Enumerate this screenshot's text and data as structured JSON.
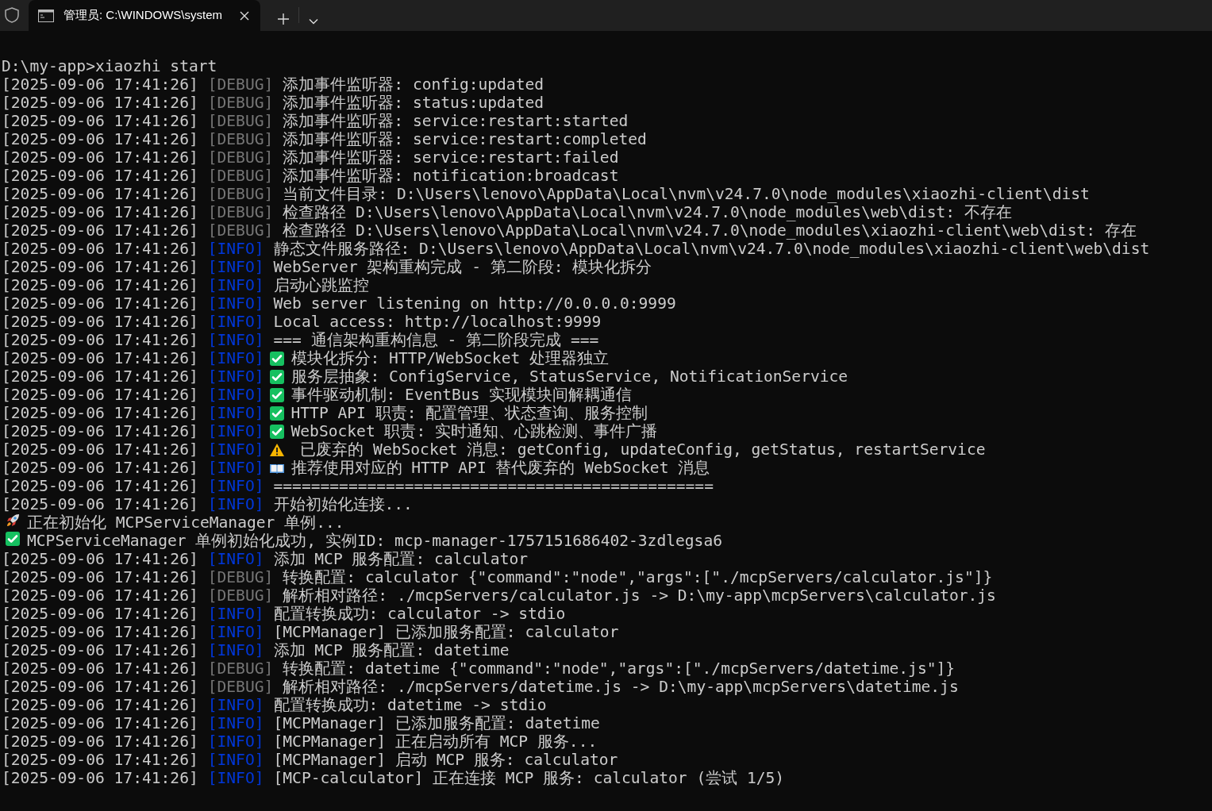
{
  "tab": {
    "title": "管理员: C:\\WINDOWS\\system",
    "selected": true
  },
  "lines": [
    {
      "kind": "command",
      "text": "D:\\my-app>xiaozhi start"
    },
    {
      "kind": "log",
      "time": "[2025-09-06 17:41:26]",
      "tag": "[DEBUG]",
      "color": "#767676",
      "message": "添加事件监听器: config:updated"
    },
    {
      "kind": "log",
      "time": "[2025-09-06 17:41:26]",
      "tag": "[DEBUG]",
      "color": "#767676",
      "message": "添加事件监听器: status:updated"
    },
    {
      "kind": "log",
      "time": "[2025-09-06 17:41:26]",
      "tag": "[DEBUG]",
      "color": "#767676",
      "message": "添加事件监听器: service:restart:started"
    },
    {
      "kind": "log",
      "time": "[2025-09-06 17:41:26]",
      "tag": "[DEBUG]",
      "color": "#767676",
      "message": "添加事件监听器: service:restart:completed"
    },
    {
      "kind": "log",
      "time": "[2025-09-06 17:41:26]",
      "tag": "[DEBUG]",
      "color": "#767676",
      "message": "添加事件监听器: service:restart:failed"
    },
    {
      "kind": "log",
      "time": "[2025-09-06 17:41:26]",
      "tag": "[DEBUG]",
      "color": "#767676",
      "message": "添加事件监听器: notification:broadcast"
    },
    {
      "kind": "log",
      "time": "[2025-09-06 17:41:26]",
      "tag": "[DEBUG]",
      "color": "#767676",
      "message": "当前文件目录: D:\\Users\\lenovo\\AppData\\Local\\nvm\\v24.7.0\\node_modules\\xiaozhi-client\\dist"
    },
    {
      "kind": "log",
      "time": "[2025-09-06 17:41:26]",
      "tag": "[DEBUG]",
      "color": "#767676",
      "message": "检查路径 D:\\Users\\lenovo\\AppData\\Local\\nvm\\v24.7.0\\node_modules\\web\\dist: 不存在"
    },
    {
      "kind": "log",
      "time": "[2025-09-06 17:41:26]",
      "tag": "[DEBUG]",
      "color": "#767676",
      "message": "检查路径 D:\\Users\\lenovo\\AppData\\Local\\nvm\\v24.7.0\\node_modules\\xiaozhi-client\\web\\dist: 存在"
    },
    {
      "kind": "log",
      "time": "[2025-09-06 17:41:26]",
      "tag": "[INFO]",
      "color": "#0037da",
      "message": "静态文件服务路径: D:\\Users\\lenovo\\AppData\\Local\\nvm\\v24.7.0\\node_modules\\xiaozhi-client\\web\\dist"
    },
    {
      "kind": "log",
      "time": "[2025-09-06 17:41:26]",
      "tag": "[INFO]",
      "color": "#0037da",
      "message": "WebServer 架构重构完成 - 第二阶段: 模块化拆分"
    },
    {
      "kind": "log",
      "time": "[2025-09-06 17:41:26]",
      "tag": "[INFO]",
      "color": "#0037da",
      "message": "启动心跳监控"
    },
    {
      "kind": "log",
      "time": "[2025-09-06 17:41:26]",
      "tag": "[INFO]",
      "color": "#0037da",
      "message": "Web server listening on http://0.0.0.0:9999"
    },
    {
      "kind": "log",
      "time": "[2025-09-06 17:41:26]",
      "tag": "[INFO]",
      "color": "#0037da",
      "message": "Local access: http://localhost:9999"
    },
    {
      "kind": "log",
      "time": "[2025-09-06 17:41:26]",
      "tag": "[INFO]",
      "color": "#0037da",
      "message": "=== 通信架构重构信息 - 第二阶段完成 ==="
    },
    {
      "kind": "log",
      "time": "[2025-09-06 17:41:26]",
      "tag": "[INFO]",
      "color": "#0037da",
      "symbol": {
        "kind": "check"
      },
      "message": "模块化拆分: HTTP/WebSocket 处理器独立"
    },
    {
      "kind": "log",
      "time": "[2025-09-06 17:41:26]",
      "tag": "[INFO]",
      "color": "#0037da",
      "symbol": {
        "kind": "check"
      },
      "message": "服务层抽象: ConfigService, StatusService, NotificationService"
    },
    {
      "kind": "log",
      "time": "[2025-09-06 17:41:26]",
      "tag": "[INFO]",
      "color": "#0037da",
      "symbol": {
        "kind": "check"
      },
      "message": "事件驱动机制: EventBus 实现模块间解耦通信"
    },
    {
      "kind": "log",
      "time": "[2025-09-06 17:41:26]",
      "tag": "[INFO]",
      "color": "#0037da",
      "symbol": {
        "kind": "check"
      },
      "message": "HTTP API 职责: 配置管理、状态查询、服务控制"
    },
    {
      "kind": "log",
      "time": "[2025-09-06 17:41:26]",
      "tag": "[INFO]",
      "color": "#0037da",
      "symbol": {
        "kind": "check"
      },
      "message": "WebSocket 职责: 实时通知、心跳检测、事件广播"
    },
    {
      "kind": "log",
      "time": "[2025-09-06 17:41:26]",
      "tag": "[INFO]",
      "color": "#0037da",
      "symbol": {
        "kind": "warning"
      },
      "message": " 已废弃的 WebSocket 消息: getConfig, updateConfig, getStatus, restartService"
    },
    {
      "kind": "log",
      "time": "[2025-09-06 17:41:26]",
      "tag": "[INFO]",
      "color": "#0037da",
      "symbol": {
        "kind": "book"
      },
      "message": "推荐使用对应的 HTTP API 替代废弃的 WebSocket 消息"
    },
    {
      "kind": "log",
      "time": "[2025-09-06 17:41:26]",
      "tag": "[INFO]",
      "color": "#0037da",
      "message": "==============================================="
    },
    {
      "kind": "log",
      "time": "[2025-09-06 17:41:26]",
      "tag": "[INFO]",
      "color": "#0037da",
      "message": "开始初始化连接..."
    },
    {
      "kind": "plain",
      "symbol": {
        "kind": "rocket"
      },
      "message": "正在初始化 MCPServiceManager 单例..."
    },
    {
      "kind": "plain",
      "symbol": {
        "kind": "check"
      },
      "message": "MCPServiceManager 单例初始化成功, 实例ID: mcp-manager-1757151686402-3zdlegsa6"
    },
    {
      "kind": "log",
      "time": "[2025-09-06 17:41:26]",
      "tag": "[INFO]",
      "color": "#0037da",
      "message": "添加 MCP 服务配置: calculator"
    },
    {
      "kind": "log",
      "time": "[2025-09-06 17:41:26]",
      "tag": "[DEBUG]",
      "color": "#767676",
      "message": "转换配置: calculator {\"command\":\"node\",\"args\":[\"./mcpServers/calculator.js\"]}"
    },
    {
      "kind": "log",
      "time": "[2025-09-06 17:41:26]",
      "tag": "[DEBUG]",
      "color": "#767676",
      "message": "解析相对路径: ./mcpServers/calculator.js -> D:\\my-app\\mcpServers\\calculator.js"
    },
    {
      "kind": "log",
      "time": "[2025-09-06 17:41:26]",
      "tag": "[INFO]",
      "color": "#0037da",
      "message": "配置转换成功: calculator -> stdio"
    },
    {
      "kind": "log",
      "time": "[2025-09-06 17:41:26]",
      "tag": "[INFO]",
      "color": "#0037da",
      "message": "[MCPManager] 已添加服务配置: calculator"
    },
    {
      "kind": "log",
      "time": "[2025-09-06 17:41:26]",
      "tag": "[INFO]",
      "color": "#0037da",
      "message": "添加 MCP 服务配置: datetime"
    },
    {
      "kind": "log",
      "time": "[2025-09-06 17:41:26]",
      "tag": "[DEBUG]",
      "color": "#767676",
      "message": "转换配置: datetime {\"command\":\"node\",\"args\":[\"./mcpServers/datetime.js\"]}"
    },
    {
      "kind": "log",
      "time": "[2025-09-06 17:41:26]",
      "tag": "[DEBUG]",
      "color": "#767676",
      "message": "解析相对路径: ./mcpServers/datetime.js -> D:\\my-app\\mcpServers\\datetime.js"
    },
    {
      "kind": "log",
      "time": "[2025-09-06 17:41:26]",
      "tag": "[INFO]",
      "color": "#0037da",
      "message": "配置转换成功: datetime -> stdio"
    },
    {
      "kind": "log",
      "time": "[2025-09-06 17:41:26]",
      "tag": "[INFO]",
      "color": "#0037da",
      "message": "[MCPManager] 已添加服务配置: datetime"
    },
    {
      "kind": "log",
      "time": "[2025-09-06 17:41:26]",
      "tag": "[INFO]",
      "color": "#0037da",
      "message": "[MCPManager] 正在启动所有 MCP 服务..."
    },
    {
      "kind": "log",
      "time": "[2025-09-06 17:41:26]",
      "tag": "[INFO]",
      "color": "#0037da",
      "message": "[MCPManager] 启动 MCP 服务: calculator"
    },
    {
      "kind": "log",
      "time": "[2025-09-06 17:41:26]",
      "tag": "[INFO]",
      "color": "#0037da",
      "message": "[MCP-calculator] 正在连接 MCP 服务: calculator (尝试 1/5)"
    }
  ]
}
